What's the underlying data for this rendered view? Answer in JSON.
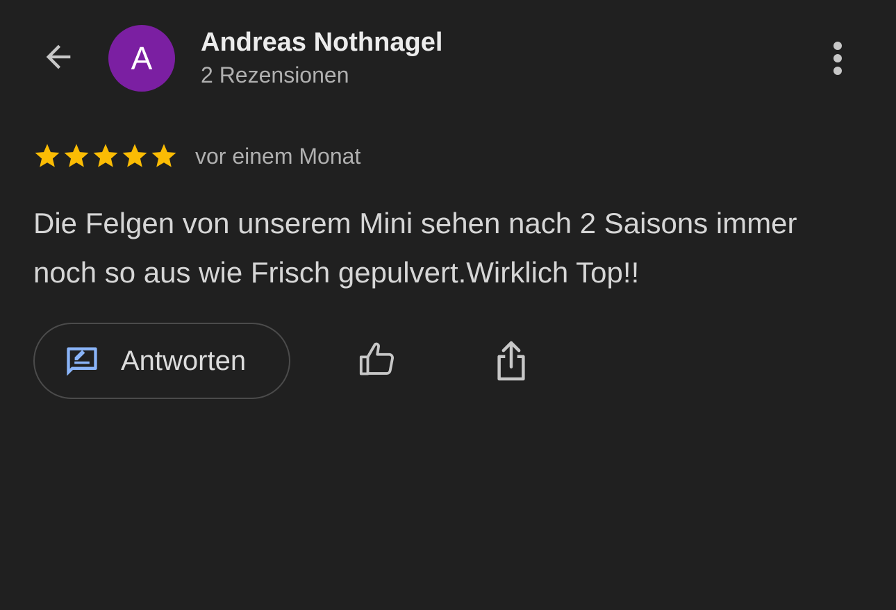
{
  "header": {
    "back_icon": "arrow-left-icon",
    "avatar_letter": "A",
    "author_name": "Andreas Nothnagel",
    "review_count": "2 Rezensionen",
    "more_icon": "more-vertical-icon"
  },
  "review": {
    "rating": 5,
    "rating_max": 5,
    "time_ago": "vor einem Monat",
    "text": "Die Felgen von unserem Mini sehen nach 2 Saisons immer noch so aus wie Frisch gepulvert.Wirklich Top!!"
  },
  "actions": {
    "reply_label": "Antworten",
    "reply_icon": "reply-edit-icon",
    "like_icon": "thumbs-up-icon",
    "share_icon": "share-icon"
  },
  "colors": {
    "background": "#202020",
    "avatar": "#7b1fa2",
    "star": "#fbbc04",
    "reply_icon": "#8ab4f8"
  }
}
